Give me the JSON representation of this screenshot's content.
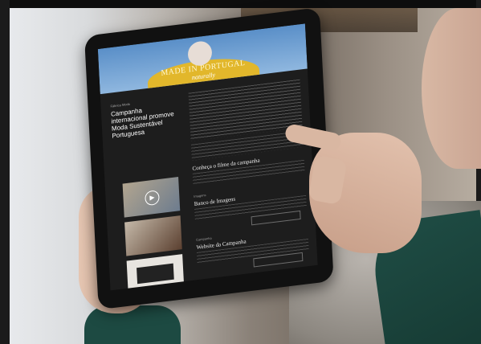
{
  "hero": {
    "title": "MADE IN PORTUGAL",
    "subtitle": "naturally"
  },
  "article": {
    "kicker": "Fábrica Moda",
    "headline": "Campanha internacional promove Moda Sustentável Portuguesa"
  },
  "sections": [
    {
      "label": "",
      "title": "Conheça o filme da campanha"
    },
    {
      "label": "Imagens",
      "title": "Banco de Imagens"
    },
    {
      "label": "Campanha",
      "title": "Website da Campanha"
    }
  ],
  "icons": {
    "play": "play-icon"
  },
  "colors": {
    "screen_bg": "#1d1d1d",
    "hero_yellow": "#e2b72b",
    "sleeve_green": "#1f4d45"
  }
}
